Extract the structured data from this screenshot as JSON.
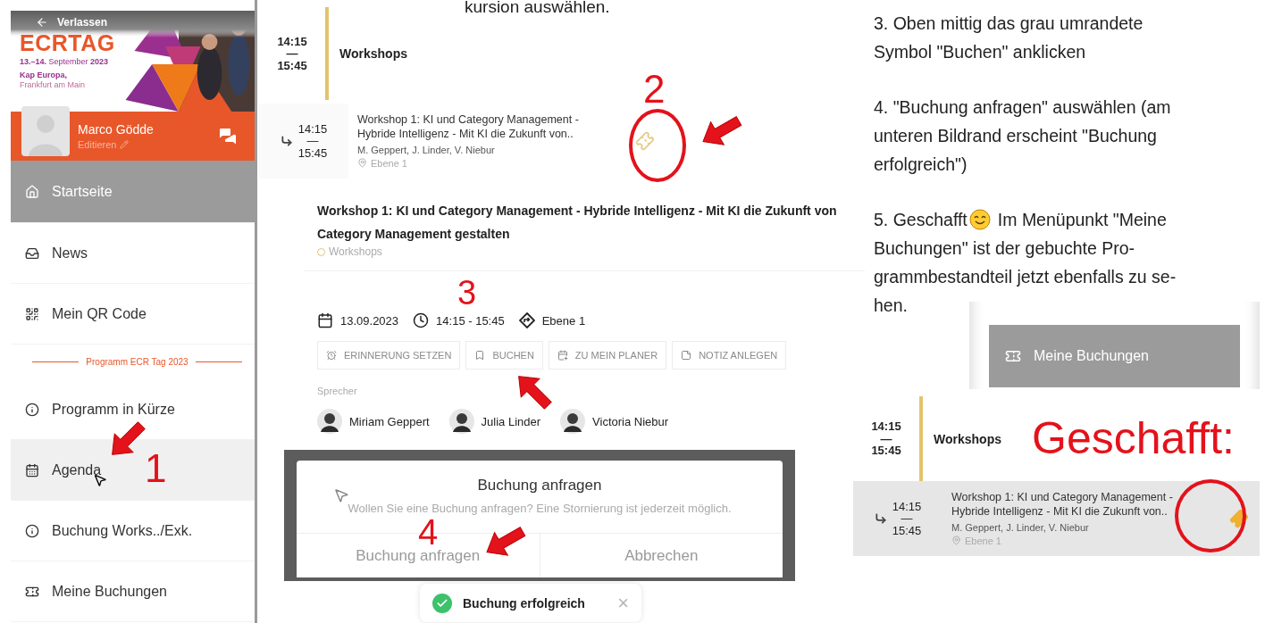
{
  "sidebar": {
    "back_label": "Verlassen",
    "logo": "ECRTAG",
    "dates": "**13.–14.** September **2023**",
    "venue": "Kap Europa,",
    "city": "Frankfurt am Main",
    "user_name": "Marco Gödde",
    "edit_label": "Editieren",
    "items": [
      {
        "kind": "item",
        "label": "Startseite",
        "selected": true,
        "highlighted": false
      },
      {
        "kind": "item",
        "label": "News",
        "selected": false,
        "highlighted": false
      },
      {
        "kind": "item",
        "label": "Mein QR Code",
        "selected": false,
        "highlighted": false
      },
      {
        "kind": "divider",
        "label": "Programm ECR Tag 2023"
      },
      {
        "kind": "item",
        "label": "Programm in Kürze",
        "selected": false,
        "highlighted": false
      },
      {
        "kind": "item",
        "label": "Agenda",
        "selected": false,
        "highlighted": true
      },
      {
        "kind": "item",
        "label": "Buchung Works../Exk.",
        "selected": false,
        "highlighted": false
      },
      {
        "kind": "item",
        "label": "Meine Buchungen",
        "selected": false,
        "highlighted": false
      }
    ]
  },
  "step_1_marker": "1",
  "instruction_top": "kursion auswählen.",
  "agenda": {
    "start": "14:15",
    "dash": "—",
    "end": "15:45",
    "title": "Workshops"
  },
  "session": {
    "start": "14:15",
    "dash": "—",
    "end": "15:45",
    "title": "Workshop 1: KI und Category Management -\nHybride Intelligenz - Mit KI die Zukunft von..",
    "speakers": "M. Geppert, J. Linder, V. Niebur",
    "location": "Ebene 1",
    "booked": false
  },
  "step_2_marker": "2",
  "detail": {
    "title": "Workshop 1: KI und Category Management - Hybride Intelligenz - Mit KI die Zukunft von\nCategory Management gestalten",
    "category": "Workshops",
    "date": "13.09.2023",
    "time": "14:15 - 15:45",
    "location": "Ebene 1",
    "actions": [
      "ERINNERUNG SETZEN",
      "BUCHEN",
      "ZU MEIN PLANER",
      "NOTIZ ANLEGEN"
    ],
    "speakers_label": "Sprecher",
    "speakers": [
      "Miriam Geppert",
      "Julia Linder",
      "Victoria Niebur"
    ]
  },
  "step_3_marker": "3",
  "dialog": {
    "title": "Buchung anfragen",
    "message": "Wollen Sie eine Buchung anfragen? Eine Stornierung ist jederzeit möglich.",
    "confirm": "Buchung anfragen",
    "cancel": "Abbrechen"
  },
  "step_4_marker": "4",
  "toast": {
    "message": "Buchung erfolgreich",
    "close": "×"
  },
  "steps": [
    {
      "text": "3. Oben mittig das grau umrandete\nSymbol \"Buchen\" anklicken"
    },
    {
      "text": "4. \"Buchung anfragen\" auswählen (am\nunteren Bildrand erscheint \"Buchung\nerfolgreich\")"
    }
  ],
  "step_5": {
    "lead": "5. Geschafft",
    "after_icon": "Im Menüpunkt \"Meine",
    "rest": "Buchungen\" ist der gebuchte Pro-\ngrammbestandteil jetzt ebenfalls zu se-\nhen."
  },
  "menu_excerpt": {
    "label": "Meine Buchungen"
  },
  "result": {
    "banner": "Geschafft:",
    "agenda": {
      "start": "14:15",
      "dash": "—",
      "end": "15:45",
      "title": "Workshops"
    },
    "session": {
      "start": "14:15",
      "dash": "—",
      "end": "15:45",
      "title": "Workshop 1: KI und Category Management -\nHybride Intelligenz - Mit KI die Zukunft von..",
      "speakers": "M. Geppert, J. Linder, V. Niebur",
      "location": "Ebene 1",
      "booked": true
    }
  }
}
